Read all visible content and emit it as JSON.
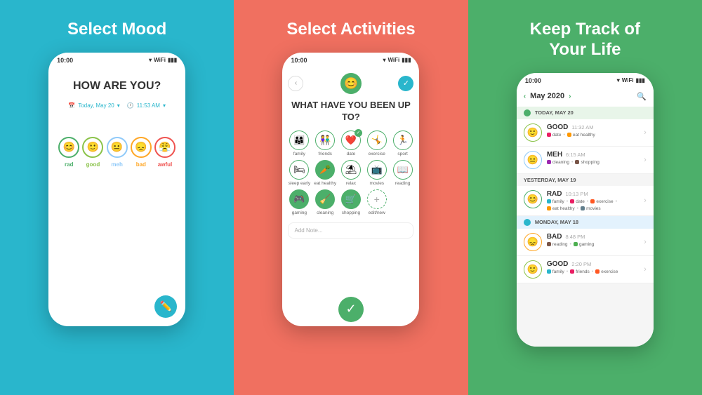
{
  "panel1": {
    "title": "Select Mood",
    "phone": {
      "status_time": "10:00",
      "question": "HOW ARE YOU?",
      "date_label": "Today, May 20",
      "time_label": "11:53 AM",
      "moods": [
        {
          "label": "rad",
          "color": "#4CAF6A",
          "emoji": "😊"
        },
        {
          "label": "good",
          "color": "#8BC34A",
          "emoji": "🙂"
        },
        {
          "label": "meh",
          "color": "#90CAF9",
          "emoji": "😐"
        },
        {
          "label": "bad",
          "color": "#FFA726",
          "emoji": "😞"
        },
        {
          "label": "awful",
          "color": "#EF5350",
          "emoji": "😤"
        }
      ]
    }
  },
  "panel2": {
    "title": "Select Activities",
    "phone": {
      "status_time": "10:00",
      "question": "WHAT HAVE YOU BEEN UP TO?",
      "activities": [
        {
          "label": "family",
          "emoji": "👨‍👩‍👧",
          "selected": false
        },
        {
          "label": "friends",
          "emoji": "👫",
          "selected": false
        },
        {
          "label": "date",
          "emoji": "❤️",
          "selected": true
        },
        {
          "label": "exercise",
          "emoji": "🤸",
          "selected": false
        },
        {
          "label": "sport",
          "emoji": "🏃",
          "selected": false
        },
        {
          "label": "sleep early",
          "emoji": "🛏",
          "selected": false
        },
        {
          "label": "eat healthy",
          "emoji": "🥕",
          "selected": true
        },
        {
          "label": "relax",
          "emoji": "⛱",
          "selected": false
        },
        {
          "label": "movies",
          "emoji": "📺",
          "selected": false
        },
        {
          "label": "reading",
          "emoji": "📖",
          "selected": false
        },
        {
          "label": "gaming",
          "emoji": "🎮",
          "selected": false
        },
        {
          "label": "cleaning",
          "emoji": "🧹",
          "selected": false
        },
        {
          "label": "shopping",
          "emoji": "🛒",
          "selected": false
        },
        {
          "label": "edit/new",
          "emoji": "+",
          "selected": false
        }
      ],
      "note_placeholder": "Add Note..."
    }
  },
  "panel3": {
    "title": "Keep Track of\nYour Life",
    "phone": {
      "status_time": "10:00",
      "month_label": "May 2020",
      "days": [
        {
          "label": "TODAY, MAY 20",
          "is_today": true,
          "entries": [
            {
              "mood": "GOOD",
              "time": "11:32 AM",
              "emoji": "🙂",
              "color": "#8BC34A",
              "tags": [
                {
                  "icon": "❤️",
                  "label": "date",
                  "color": "#E91E63"
                },
                {
                  "icon": "🥕",
                  "label": "eat healthy",
                  "color": "#FF9800"
                }
              ]
            },
            {
              "mood": "MEH",
              "time": "6:15 AM",
              "emoji": "😐",
              "color": "#90CAF9",
              "tags": [
                {
                  "icon": "🧹",
                  "label": "cleaning",
                  "color": "#9C27B0"
                },
                {
                  "icon": "🛒",
                  "label": "shopping",
                  "color": "#795548"
                }
              ]
            }
          ]
        },
        {
          "label": "YESTERDAY, MAY 19",
          "is_today": false,
          "entries": [
            {
              "mood": "RAD",
              "time": "10:13 PM",
              "emoji": "😊",
              "color": "#4CAF6A",
              "tags": [
                {
                  "icon": "👨‍👩‍👧",
                  "label": "family",
                  "color": "#29B6CC"
                },
                {
                  "icon": "❤️",
                  "label": "date",
                  "color": "#E91E63"
                },
                {
                  "icon": "🤸",
                  "label": "exercise",
                  "color": "#FF5722"
                },
                {
                  "icon": "🥕",
                  "label": "eat healthy",
                  "color": "#FF9800"
                },
                {
                  "icon": "📺",
                  "label": "movies",
                  "color": "#607D8B"
                }
              ]
            }
          ]
        },
        {
          "label": "MONDAY, MAY 18",
          "is_today": false,
          "entries": [
            {
              "mood": "BAD",
              "time": "8:48 PM",
              "emoji": "😞",
              "color": "#FFA726",
              "tags": [
                {
                  "icon": "📖",
                  "label": "reading",
                  "color": "#795548"
                },
                {
                  "icon": "🎮",
                  "label": "gaming",
                  "color": "#4CAF50"
                }
              ]
            },
            {
              "mood": "GOOD",
              "time": "2:20 PM",
              "emoji": "🙂",
              "color": "#8BC34A",
              "tags": [
                {
                  "icon": "👨‍👩‍👧",
                  "label": "family",
                  "color": "#29B6CC"
                },
                {
                  "icon": "👫",
                  "label": "friends",
                  "color": "#E91E63"
                },
                {
                  "icon": "🤸",
                  "label": "exercise",
                  "color": "#FF5722"
                }
              ]
            }
          ]
        }
      ]
    }
  }
}
